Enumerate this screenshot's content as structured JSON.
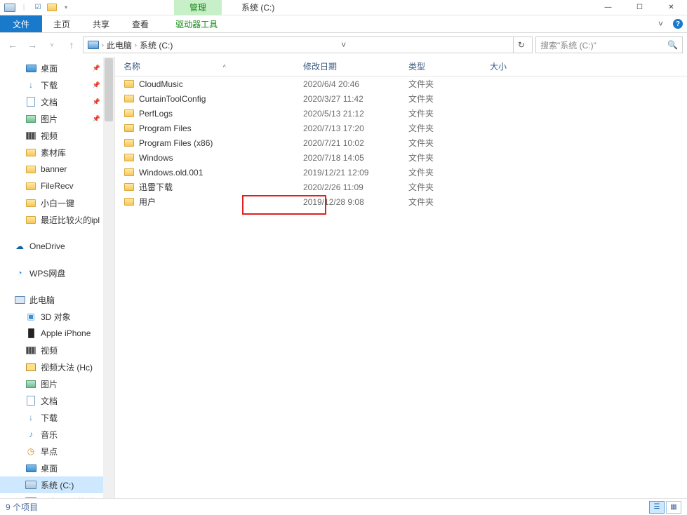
{
  "window": {
    "title": "系统 (C:)",
    "contextual_tab": "管理",
    "min": "—",
    "max": "☐",
    "close": "✕"
  },
  "ribbon": {
    "file": "文件",
    "home": "主页",
    "share": "共享",
    "view": "查看",
    "drive_tools": "驱动器工具",
    "expand": "˅",
    "help": "?"
  },
  "nav": {
    "back": "←",
    "forward": "→",
    "recent": "˅",
    "up": "↑",
    "this_pc": "此电脑",
    "drive": "系统 (C:)",
    "dropdown": "˅",
    "refresh": "↻"
  },
  "search": {
    "placeholder": "搜索\"系统 (C:)\"",
    "icon": "🔍"
  },
  "tree": [
    {
      "icon": "desktop",
      "label": "桌面",
      "pin": true,
      "indent": true
    },
    {
      "icon": "download",
      "label": "下载",
      "pin": true,
      "indent": true
    },
    {
      "icon": "doc",
      "label": "文档",
      "pin": true,
      "indent": true
    },
    {
      "icon": "pic",
      "label": "图片",
      "pin": true,
      "indent": true
    },
    {
      "icon": "video",
      "label": "视频",
      "indent": true
    },
    {
      "icon": "folder",
      "label": "素材库",
      "indent": true
    },
    {
      "icon": "folder",
      "label": "banner",
      "indent": true
    },
    {
      "icon": "folder",
      "label": "FileRecv",
      "indent": true
    },
    {
      "icon": "folder",
      "label": "小白一键",
      "indent": true
    },
    {
      "icon": "folder",
      "label": "最近比较火的ipl",
      "indent": true
    },
    {
      "sep": true
    },
    {
      "icon": "cloud",
      "label": "OneDrive",
      "indent": false
    },
    {
      "sep": true
    },
    {
      "icon": "wps",
      "label": "WPS网盘",
      "indent": false
    },
    {
      "sep": true
    },
    {
      "icon": "pc",
      "label": "此电脑",
      "indent": false
    },
    {
      "icon": "cube",
      "label": "3D 对象",
      "indent": true
    },
    {
      "icon": "phone",
      "label": "Apple iPhone",
      "indent": true
    },
    {
      "icon": "video",
      "label": "视频",
      "indent": true
    },
    {
      "icon": "video2",
      "label": "视频大法 (Hc)",
      "indent": true
    },
    {
      "icon": "pic",
      "label": "图片",
      "indent": true
    },
    {
      "icon": "doc",
      "label": "文档",
      "indent": true
    },
    {
      "icon": "download",
      "label": "下载",
      "indent": true
    },
    {
      "icon": "music",
      "label": "音乐",
      "indent": true
    },
    {
      "icon": "clock",
      "label": "早点",
      "indent": true
    },
    {
      "icon": "desktop",
      "label": "桌面",
      "indent": true
    },
    {
      "icon": "drive",
      "label": "系统 (C:)",
      "indent": true,
      "sel": true
    },
    {
      "icon": "drive",
      "label": "小白  键重装系",
      "indent": true
    }
  ],
  "columns": {
    "name": "名称",
    "date": "修改日期",
    "type": "类型",
    "size": "大小"
  },
  "rows": [
    {
      "name": "CloudMusic",
      "date": "2020/6/4 20:46",
      "type": "文件夹"
    },
    {
      "name": "CurtainToolConfig",
      "date": "2020/3/27 11:42",
      "type": "文件夹"
    },
    {
      "name": "PerfLogs",
      "date": "2020/5/13 21:12",
      "type": "文件夹"
    },
    {
      "name": "Program Files",
      "date": "2020/7/13 17:20",
      "type": "文件夹"
    },
    {
      "name": "Program Files (x86)",
      "date": "2020/7/21 10:02",
      "type": "文件夹"
    },
    {
      "name": "Windows",
      "date": "2020/7/18 14:05",
      "type": "文件夹"
    },
    {
      "name": "Windows.old.001",
      "date": "2019/12/21 12:09",
      "type": "文件夹"
    },
    {
      "name": "迅雷下载",
      "date": "2020/2/26 11:09",
      "type": "文件夹"
    },
    {
      "name": "用户",
      "date": "2019/12/28 9:08",
      "type": "文件夹"
    }
  ],
  "status": {
    "count": "9 个项目"
  }
}
